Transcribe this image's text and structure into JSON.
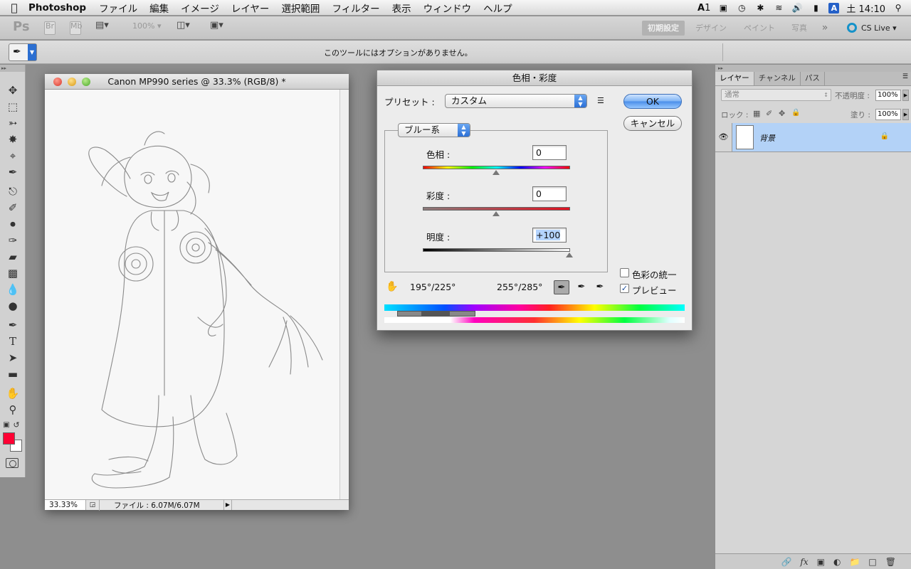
{
  "menubar": {
    "app_name": "Photoshop",
    "items": [
      "ファイル",
      "編集",
      "イメージ",
      "レイヤー",
      "選択範囲",
      "フィルター",
      "表示",
      "ウィンドウ",
      "ヘルプ"
    ],
    "status": {
      "adobe_badge": "1",
      "ime": "A",
      "datetime": "土 14:10"
    }
  },
  "appbar": {
    "logo": "Ps",
    "bridge": "Br",
    "minibridge": "Mb",
    "zoom": "100%",
    "workspaces": [
      "初期設定",
      "デザイン",
      "ペイント",
      "写真"
    ],
    "cs_live": "CS Live"
  },
  "options": {
    "message": "このツールにはオプションがありません。"
  },
  "document": {
    "title": "Canon MP990 series @ 33.3% (RGB/8) *",
    "zoom": "33.33%",
    "file_info": "ファイル : 6.07M/6.07M"
  },
  "dialog": {
    "title": "色相・彩度",
    "preset_label": "プリセット :",
    "preset_value": "カスタム",
    "ok": "OK",
    "cancel": "キャンセル",
    "channel": "ブルー系",
    "hue_label": "色相 :",
    "hue_value": "0",
    "saturation_label": "彩度 :",
    "saturation_value": "0",
    "lightness_label": "明度 :",
    "lightness_value": "+100",
    "colorize_label": "色彩の統一",
    "colorize_checked": false,
    "preview_label": "プレビュー",
    "preview_checked": true,
    "range_left": "195°/225°",
    "range_right": "255°/285°"
  },
  "layers_panel": {
    "tabs": [
      "レイヤー",
      "チャンネル",
      "パス"
    ],
    "blend_mode": "通常",
    "opacity_label": "不透明度 :",
    "opacity_value": "100%",
    "lock_label": "ロック :",
    "fill_label": "塗り :",
    "fill_value": "100%",
    "layers": [
      {
        "name": "背景",
        "locked": true,
        "visible": true
      }
    ]
  },
  "colors": {
    "foreground": "#ff0033",
    "background": "#ffffff",
    "selection": "#b3d2f7"
  }
}
